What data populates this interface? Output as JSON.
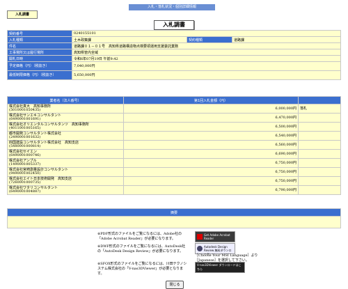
{
  "header": {
    "bar_title": "入札・落札状況・個別詳細情報",
    "section_tag": "入札調書",
    "page_title": "入札調書"
  },
  "info_rows": [
    {
      "label": "契約番号",
      "value": "0240155101"
    },
    {
      "label": "入札種類",
      "value": "土木政策課",
      "label2": "契約種類",
      "value2": "道路課"
    },
    {
      "label": "件名",
      "value": "道路課０１－０１号　高知県道路構造物点検要領運用支援委託業務"
    },
    {
      "label": "工事場所又は履行場所",
      "value": "高知県管内全域"
    },
    {
      "label": "開札日時",
      "value": "令和6年07月19日 午前9:42"
    },
    {
      "label": "予定価格（円）（税抜き）",
      "value": "7,040,000円"
    },
    {
      "label": "最低制限価格（円）（税抜き）",
      "value": "5,650,000円"
    }
  ],
  "bids": {
    "headers": [
      "業者名（法人番号）",
      "第1回入札金額（円）",
      ""
    ],
    "rows": [
      {
        "name": "株式会社真大　高知事務所",
        "corp": "(5010001050435)",
        "amount": "6,000,000円",
        "remark": "落札"
      },
      {
        "name": "株式会社サンエキコンサルタント",
        "corp": "(6490001001691)",
        "amount": "6,470,000円",
        "remark": ""
      },
      {
        "name": "株式会社オリエンタルコンサルタンツ　高知事務所",
        "corp": "(4011001005165)",
        "amount": "6,500,000円",
        "remark": ""
      },
      {
        "name": "都市開発コンサルタント株式会社",
        "corp": "(2490001001632)",
        "amount": "6,540,000円",
        "remark": ""
      },
      {
        "name": "四国建設コンサルタント株式会社　高知支店",
        "corp": "(5480001000814)",
        "amount": "6,560,000円",
        "remark": ""
      },
      {
        "name": "株式会社セイエン",
        "corp": "(6490001000746)",
        "amount": "6,690,000円",
        "remark": ""
      },
      {
        "name": "株式会社アンプル",
        "corp": "(1490001005337)",
        "amount": "6,750,000円",
        "remark": ""
      },
      {
        "name": "株式会社宮崎測量設計コンサルタント",
        "corp": "(9490001002450)",
        "amount": "6,750,000円",
        "remark": ""
      },
      {
        "name": "株式会社エイト日本技術開発　高知支店",
        "corp": "(7260001000735)",
        "amount": "6,750,000円",
        "remark": ""
      },
      {
        "name": "株式会社ワタリコンサルタント",
        "corp": "(6490001004887)",
        "amount": "6,790,000円",
        "remark": ""
      }
    ]
  },
  "remarks": {
    "header": "摘要",
    "value": ""
  },
  "notes": {
    "pdf": "※PDF形式のファイルをご覧になるには、Adobe社の「Adobe Acrobat Reader」が必要になります。",
    "dwf": "※DWF形式のファイルをご覧になるには、AutoDesk社の「AutoDesk Design Review」が必要になります。",
    "dwf_right": "［Choose Your MSI Language］より［Japanese］を選択して下さい。",
    "sfx": "※SFOX形式のファイルをご覧になるには、川田テクノシステム株式会社の「V-nas3DViewer」が必要となります。",
    "badge_pdf": "Get Adobe Acrobat Reader",
    "badge_dwf": "Autodesk Design Review 無料ダウンロード",
    "badge_vnas": "V-nas3DViewer ダウンロードはこちら"
  },
  "close_label": "閉じる"
}
